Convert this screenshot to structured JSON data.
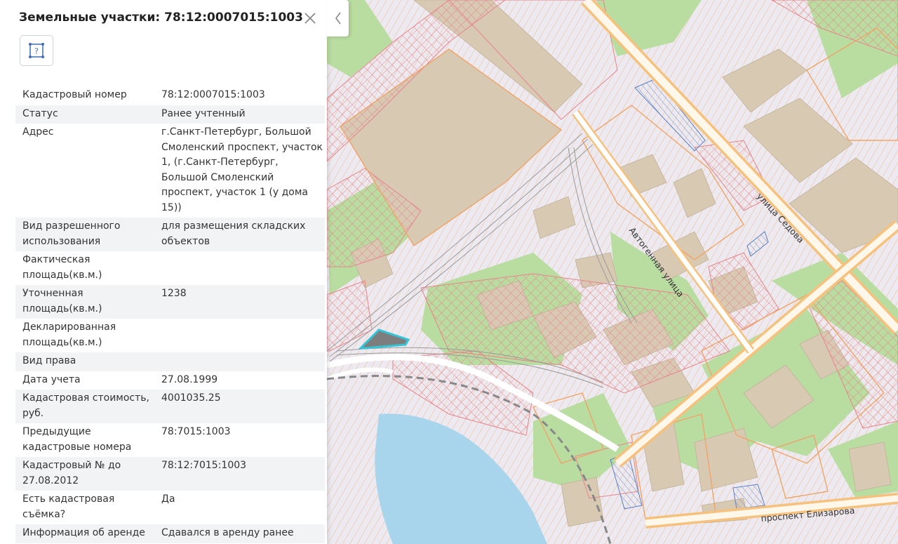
{
  "panel": {
    "title": "Земельные участки: 78:12:0007015:1003",
    "icon_button_glyph": "?",
    "properties": [
      {
        "key": "Кадастровый номер",
        "value": "78:12:0007015:1003"
      },
      {
        "key": "Статус",
        "value": "Ранее учтенный"
      },
      {
        "key": "Адрес",
        "value": "г.Санкт-Петербург, Большой Смоленский проспект, участок 1, (г.Санкт-Петербург, Большой Смоленский проспект, участок 1 (у дома 15))"
      },
      {
        "key": "Вид разрешенного использования",
        "value": "для размещения складских объектов"
      },
      {
        "key": "Фактическая площадь(кв.м.)",
        "value": ""
      },
      {
        "key": "Уточненная площадь(кв.м.)",
        "value": "1238"
      },
      {
        "key": "Декларированная площадь(кв.м.)",
        "value": ""
      },
      {
        "key": "Вид права",
        "value": ""
      },
      {
        "key": "Дата учета",
        "value": "27.08.1999"
      },
      {
        "key": "Кадастровая стоимость, руб.",
        "value": "4001035.25"
      },
      {
        "key": "Предыдущие кадастровые номера",
        "value": "78:7015:1003"
      },
      {
        "key": "Кадастровый № до 27.08.2012",
        "value": "78:12:7015:1003"
      },
      {
        "key": "Есть кадастровая съёмка?",
        "value": "Да"
      },
      {
        "key": "Информация об аренде",
        "value": "Сдавался в аренду ранее"
      }
    ]
  },
  "map": {
    "streets": {
      "sedova": "улица Седова",
      "avtogennaya": "Автогенная улица",
      "elizarova": "проспект Елизарова"
    }
  },
  "colors": {
    "parcel_orange": "#f0a468",
    "parcel_red": "#e8838b",
    "building": "#d8c9b3",
    "green": "#b9dca0",
    "water": "#a9d5ec",
    "selected_fill": "#7d7d7d",
    "selected_outline": "#35c4d6"
  }
}
